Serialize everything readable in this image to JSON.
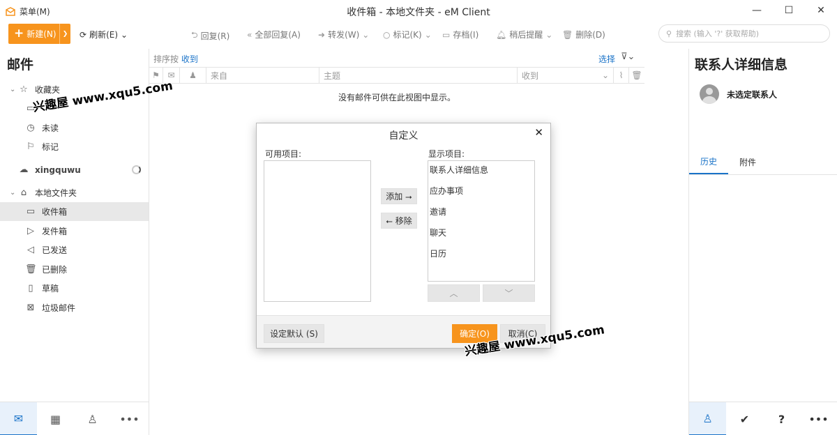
{
  "titlebar": {
    "menu_label": "菜单(M)",
    "title": "收件箱 - 本地文件夹 - eM Client"
  },
  "toolbar": {
    "new_label": "新建(N)",
    "refresh_label": "刷新(E)",
    "reply_label": "回复(R)",
    "reply_all_label": "全部回复(A)",
    "forward_label": "转发(W)",
    "mark_label": "标记(K)",
    "archive_label": "存档(I)",
    "snooze_label": "稍后提醒",
    "delete_label": "删除(D)",
    "search_placeholder": "搜索 (输入 '?' 获取帮助)"
  },
  "sidebar": {
    "title": "邮件",
    "favorites": "收藏夹",
    "unread": "未读",
    "flagged": "标记",
    "account": "xingquwu",
    "local_folders": "本地文件夹",
    "folders": {
      "inbox": "收件箱",
      "outbox": "发件箱",
      "sent": "已发送",
      "deleted": "已删除",
      "drafts": "草稿",
      "junk": "垃圾邮件"
    }
  },
  "msglist": {
    "sort_by": "排序按",
    "sort_field": "收到",
    "select_label": "选择",
    "columns": {
      "from": "来自",
      "subject": "主题",
      "received": "收到"
    },
    "empty_message": "没有邮件可供在此视图中显示。"
  },
  "rpanel": {
    "title": "联系人详细信息",
    "no_contact": "未选定联系人",
    "tabs": {
      "history": "历史",
      "attachments": "附件"
    }
  },
  "dialog": {
    "title": "自定义",
    "available_label": "可用项目:",
    "shown_label": "显示项目:",
    "shown_items": [
      "联系人详细信息",
      "应办事项",
      "邀请",
      "聊天",
      "日历"
    ],
    "add_button": "添加 ⭢",
    "remove_button": "⭠ 移除",
    "set_default": "设定默认 (S)",
    "ok": "确定(O)",
    "cancel": "取消(C)"
  },
  "watermarks": {
    "top": "兴趣屋 www.xqu5.com",
    "bottom": "兴趣屋 www.xqu5.com"
  },
  "colors": {
    "accent_orange": "#f7941d",
    "accent_blue": "#1a73c8"
  }
}
